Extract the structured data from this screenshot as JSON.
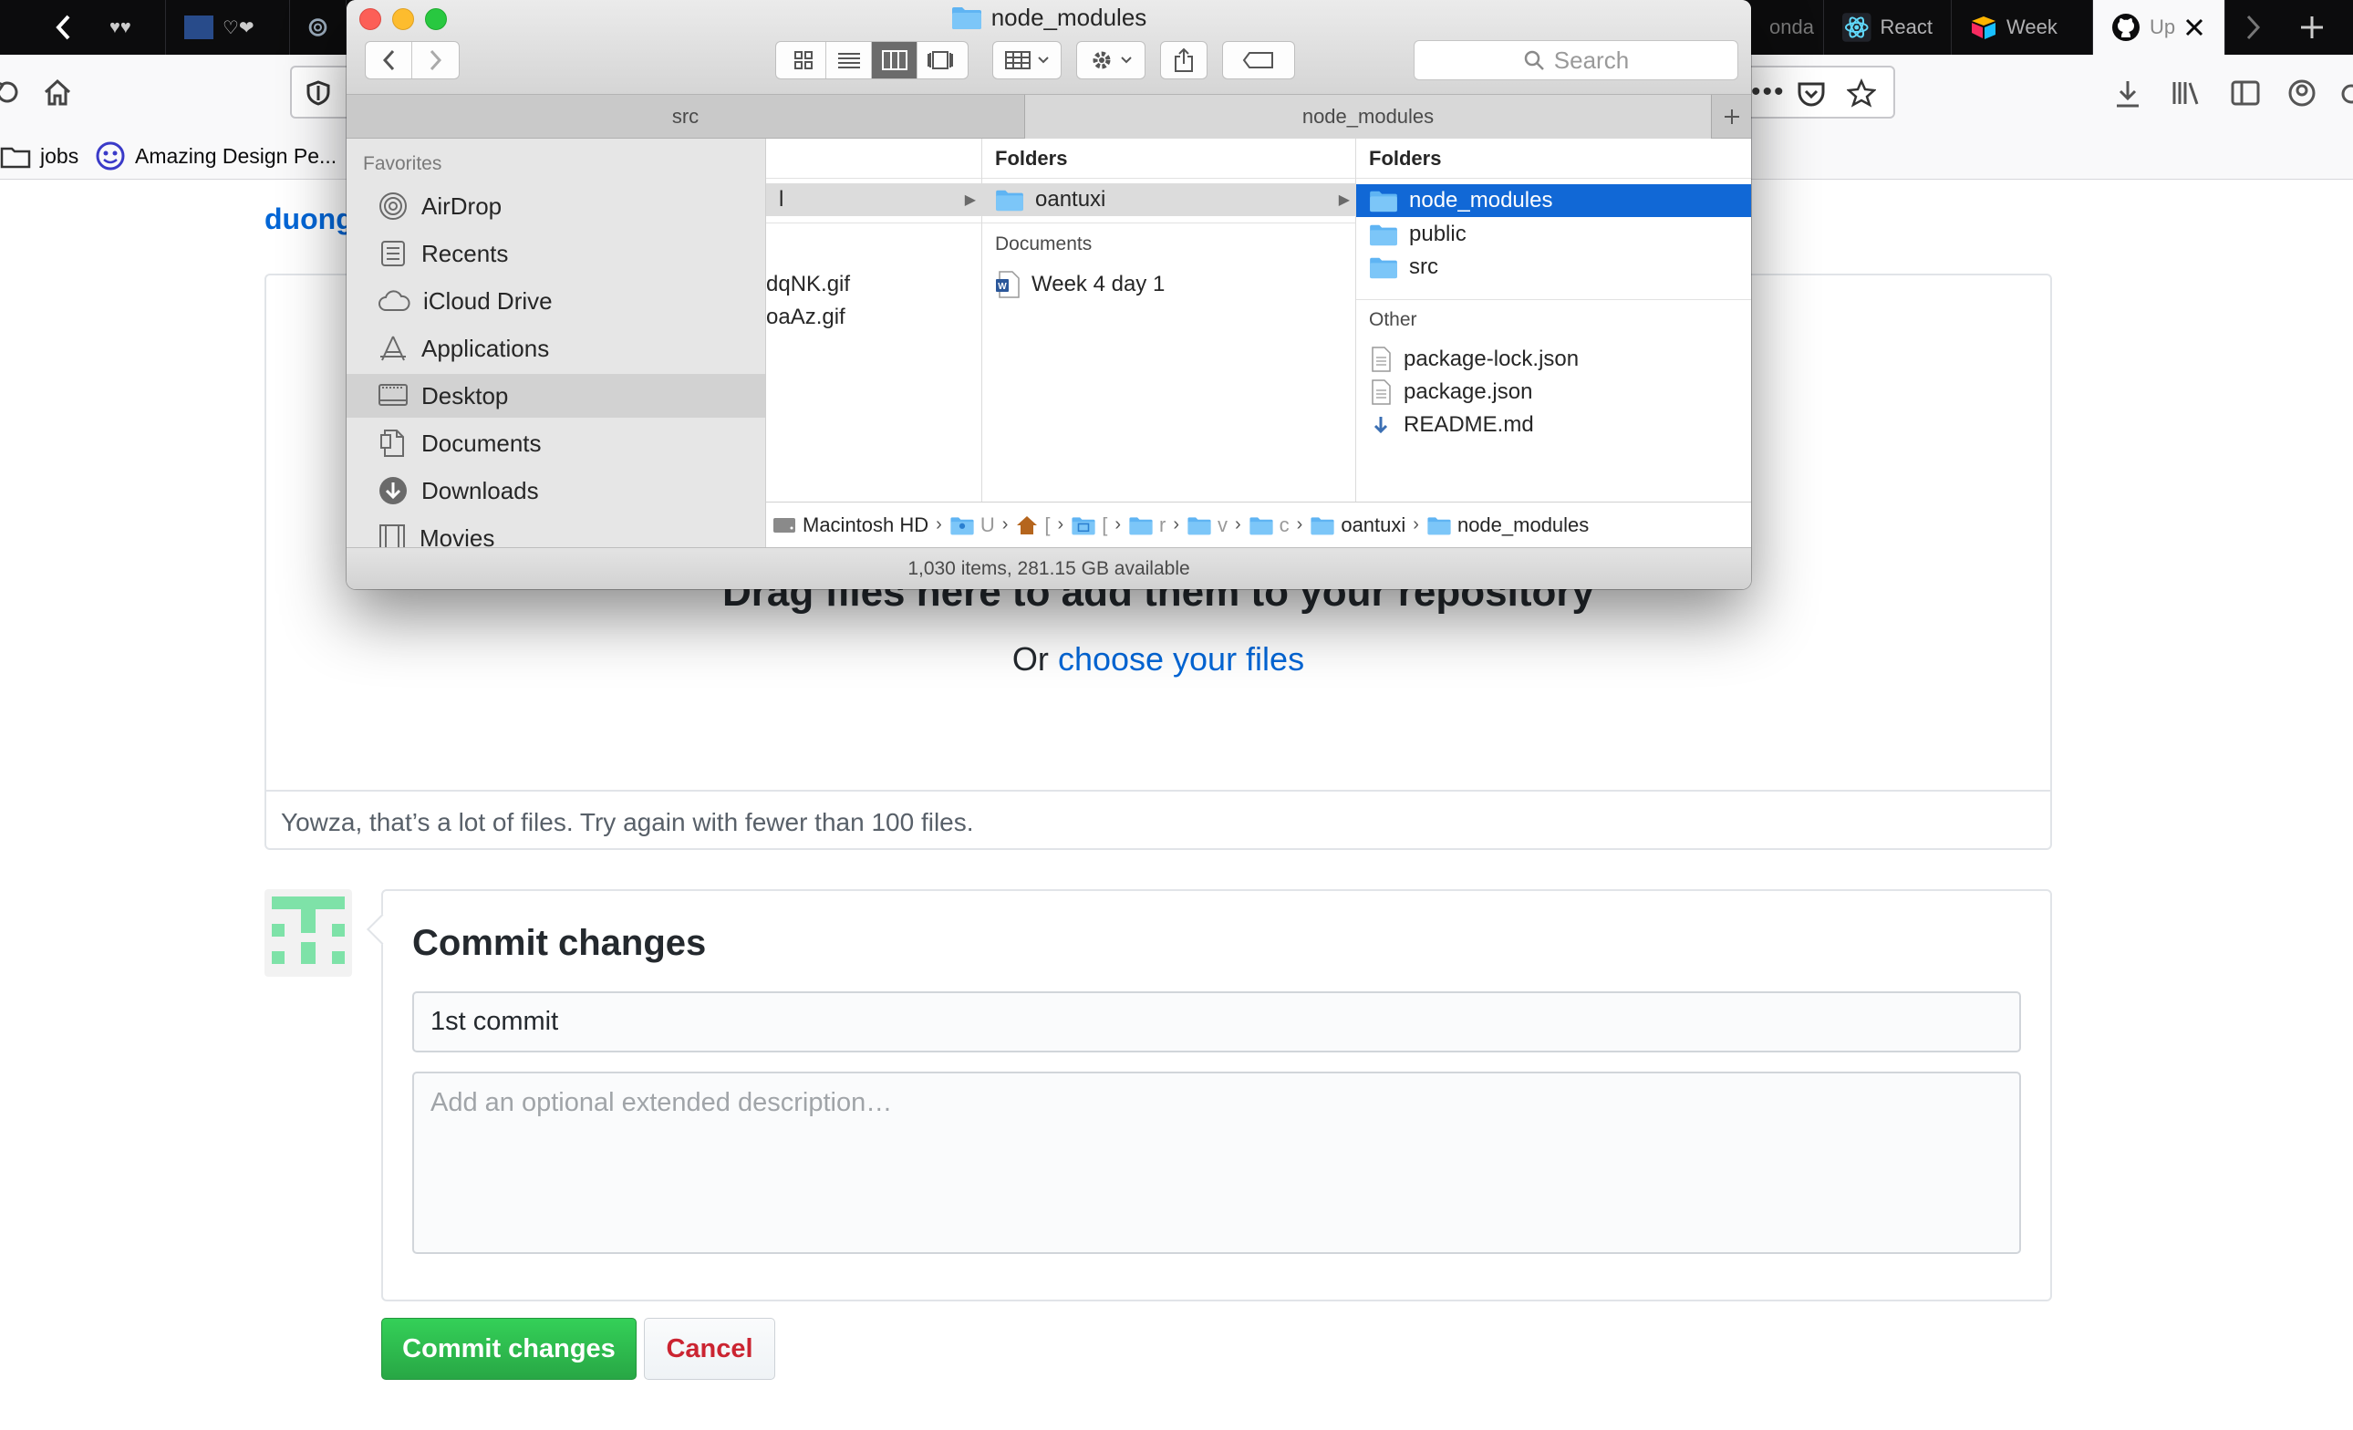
{
  "browser": {
    "tabs": [
      {
        "label": ""
      },
      {
        "label": ""
      },
      {
        "label": ""
      },
      {
        "label": "onda"
      },
      {
        "label": "React"
      },
      {
        "label": "Week"
      },
      {
        "label": "Up"
      }
    ],
    "bookmarks": [
      {
        "label": "jobs"
      },
      {
        "label": "Amazing Design Pe..."
      }
    ]
  },
  "page": {
    "owner": "duong",
    "drop_title": "Drag files here to add them to your repository",
    "drop_or": "Or",
    "drop_choose": "choose your files",
    "drop_error": "Yowza, that’s a lot of files. Try again with fewer than 100 files.",
    "commit": {
      "title": "Commit changes",
      "summary_value": "1st commit",
      "description_placeholder": "Add an optional extended description…",
      "submit_label": "Commit changes",
      "cancel_label": "Cancel"
    }
  },
  "finder": {
    "title": "node_modules",
    "search_placeholder": "Search",
    "tabs": [
      {
        "label": "src"
      },
      {
        "label": "node_modules"
      }
    ],
    "favorites_heading": "Favorites",
    "favorites": [
      {
        "label": "AirDrop",
        "icon": "airdrop-icon"
      },
      {
        "label": "Recents",
        "icon": "recents-icon"
      },
      {
        "label": "iCloud Drive",
        "icon": "cloud-icon"
      },
      {
        "label": "Applications",
        "icon": "applications-icon"
      },
      {
        "label": "Desktop",
        "icon": "desktop-icon",
        "selected": true
      },
      {
        "label": "Documents",
        "icon": "documents-icon"
      },
      {
        "label": "Downloads",
        "icon": "downloads-icon"
      },
      {
        "label": "Movies",
        "icon": "movies-icon"
      }
    ],
    "col1": {
      "selected_fragment": "l",
      "files": [
        {
          "label": "dqNK.gif"
        },
        {
          "label": "oaAz.gif"
        }
      ]
    },
    "col2": {
      "heading": "Folders",
      "folders": [
        {
          "label": "oantuxi"
        }
      ],
      "subheading": "Documents",
      "documents": [
        {
          "label": "Week 4 day 1"
        }
      ]
    },
    "col3": {
      "heading": "Folders",
      "folders": [
        {
          "label": "node_modules"
        },
        {
          "label": "public"
        },
        {
          "label": "src"
        }
      ],
      "subheading": "Other",
      "files": [
        {
          "label": "package-lock.json"
        },
        {
          "label": "package.json"
        },
        {
          "label": "README.md"
        }
      ]
    },
    "path": [
      {
        "label": "Macintosh HD"
      },
      {
        "label": "U"
      },
      {
        "label": "["
      },
      {
        "label": "["
      },
      {
        "label": "r"
      },
      {
        "label": "v"
      },
      {
        "label": "c"
      },
      {
        "label": "oantuxi"
      },
      {
        "label": "node_modules"
      }
    ],
    "status": "1,030 items, 281.15 GB available"
  },
  "colors": {
    "link": "#0366d6",
    "primary_button": "#28a745",
    "danger_text": "#cb2431",
    "finder_selection": "#1168d6",
    "folder": "#5fb4f3"
  }
}
